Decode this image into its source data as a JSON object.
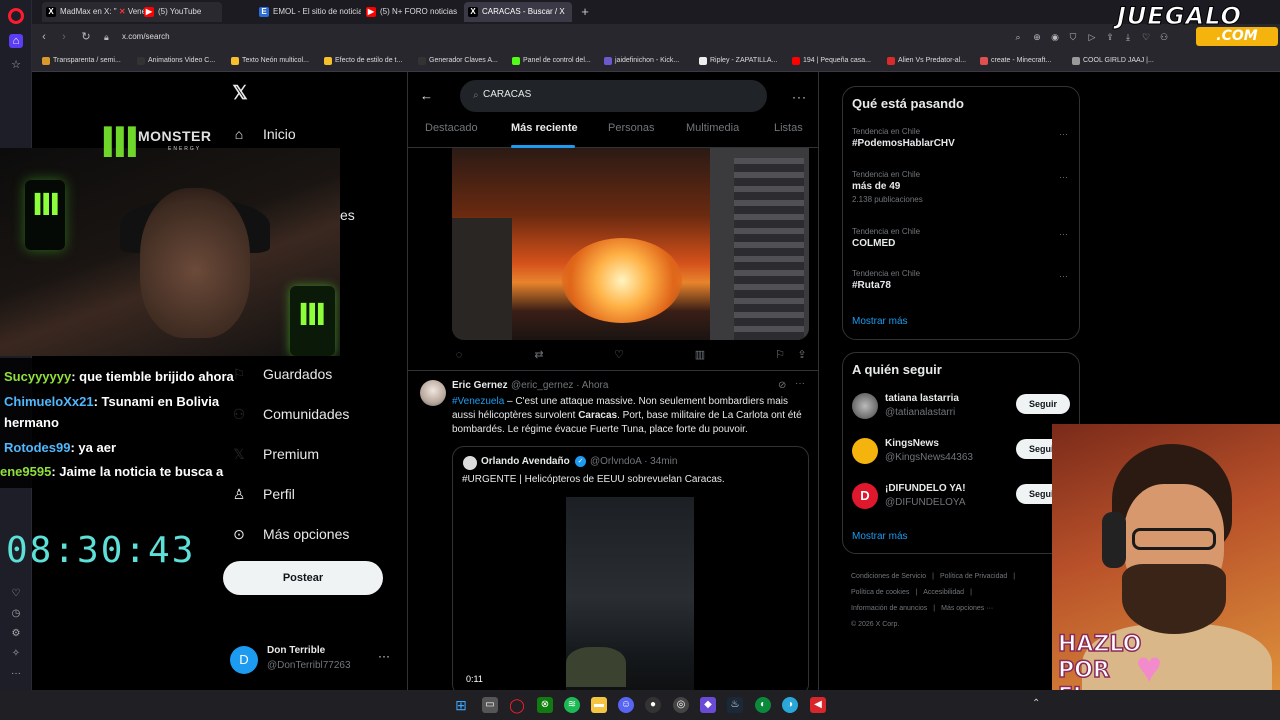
{
  "browser": {
    "tabs": [
      {
        "label": "MadMax en X: \"",
        "extra": "Venez",
        "icon": "x-icon"
      },
      {
        "label": "(5) YouTube",
        "icon": "youtube-icon"
      },
      {
        "label": "EMOL - El sitio de noticias",
        "icon": "emol-icon"
      },
      {
        "label": "(5) N+ FORO noticias",
        "icon": "youtube-icon"
      },
      {
        "label": "CARACAS - Buscar / X",
        "icon": "x-icon"
      }
    ],
    "url": "x.com/search",
    "bookmarks": [
      {
        "label": "Transparenta / semi...",
        "color": "#d99a2b"
      },
      {
        "label": "Animations Video C...",
        "color": "#333333"
      },
      {
        "label": "Texto Neón multicol...",
        "color": "#f6c02c"
      },
      {
        "label": "Efecto de estilo de t...",
        "color": "#f6c02c"
      },
      {
        "label": "Generador Claves A...",
        "color": "#333333"
      },
      {
        "label": "Panel de control del...",
        "color": "#53fc18"
      },
      {
        "label": "jaidefinichon - Kick...",
        "color": "#6a5acd"
      },
      {
        "label": "Ripley - ZAPATILLA...",
        "color": "#eeeeee"
      },
      {
        "label": "194 | Pequeña casa...",
        "color": "#ff0000"
      },
      {
        "label": "Alien Vs Predator-al...",
        "color": "#d92b2b"
      },
      {
        "label": "create - Minecraft...",
        "color": "#e05050"
      },
      {
        "label": "COOL GIRLD JAAJ |...",
        "color": "#999999"
      }
    ]
  },
  "watermark": {
    "name": "JUEGALO",
    "tld": ".COM"
  },
  "x_nav": {
    "items": [
      {
        "label": "Inicio",
        "icon": "home-icon"
      },
      {
        "label": "Guardados",
        "icon": "bookmark-icon"
      },
      {
        "label": "Comunidades",
        "icon": "communities-icon"
      },
      {
        "label": "Premium",
        "icon": "x-premium-icon"
      },
      {
        "label": "Perfil",
        "icon": "profile-icon"
      },
      {
        "label": "Más opciones",
        "icon": "more-options-icon"
      }
    ],
    "partial_label": "es",
    "post_button": "Postear",
    "account": {
      "name": "Don Terrible",
      "handle": "@DonTerribl77263",
      "initial": "D"
    }
  },
  "overlay": {
    "brand": {
      "top": "MONSTER",
      "sub": "ENERGY"
    },
    "chat": [
      {
        "user": "Sucyyyyyy",
        "msg": ": que tiemble brijido ahora"
      },
      {
        "user": "ChimueloXx21",
        "msg": ": Tsunami en Bolivia"
      },
      {
        "user": "",
        "msg": "hermano"
      },
      {
        "user": "Rotodes99",
        "msg": ": ya aer"
      },
      {
        "user": "ene9595",
        "msg": ": Jaime la noticia te busca a"
      }
    ],
    "clock": "08:30:43",
    "cartoon_text": [
      "HAZLO",
      "POR",
      "EL"
    ]
  },
  "search": {
    "query": "CARACAS",
    "tabs": [
      "Destacado",
      "Más reciente",
      "Personas",
      "Multimedia",
      "Listas"
    ],
    "active_tab": "Más reciente"
  },
  "tweet": {
    "name": "Eric Gernez",
    "handle": "@eric_gernez",
    "time": "· Ahora",
    "hashtag": "#Venezuela",
    "text_a": " – C'est une attaque massive. Non seulement bombardiers mais aussi hélicoptères survolent ",
    "text_bold": "Caracas",
    "text_b": ". Port, base militaire de La Carlota ont été bombardés. Le régime évacue Fuerte Tuna, place forte du pouvoir.",
    "quote": {
      "name": "Orlando Avendaño",
      "handle": "@OrlvndoA",
      "time": "· 34min",
      "text": "#URGENTE | Helicópteros de EEUU sobrevuelan Caracas.",
      "video_duration": "0:11"
    }
  },
  "trends": {
    "title": "Qué está pasando",
    "items": [
      {
        "context": "Tendencia en Chile",
        "name": "#PodemosHablarCHV",
        "count": ""
      },
      {
        "context": "Tendencia en Chile",
        "name": "más de 49",
        "count": "2.138 publicaciones"
      },
      {
        "context": "Tendencia en Chile",
        "name": "COLMED",
        "count": ""
      },
      {
        "context": "Tendencia en Chile",
        "name": "#Ruta78",
        "count": ""
      }
    ],
    "show_more": "Mostrar más"
  },
  "who_to_follow": {
    "title": "A quién seguir",
    "items": [
      {
        "name": "tatiana lastarria",
        "handle": "@tatianalastarri",
        "button": "Seguir"
      },
      {
        "name": "KingsNews",
        "handle": "@KingsNews44363",
        "button": "Seguir"
      },
      {
        "name": "¡DIFUNDELO YA!",
        "handle": "@DIFUNDELOYA",
        "button": "Seguir"
      }
    ],
    "show_more": "Mostrar más"
  },
  "footer": {
    "links": [
      "Condiciones de Servicio",
      "|",
      "Política de Privacidad",
      "|",
      "Política de cookies",
      "|",
      "Accesibilidad",
      "|",
      "Información de anuncios",
      "|",
      "Más opciones ···"
    ],
    "copyright": "© 2026 X Corp."
  }
}
